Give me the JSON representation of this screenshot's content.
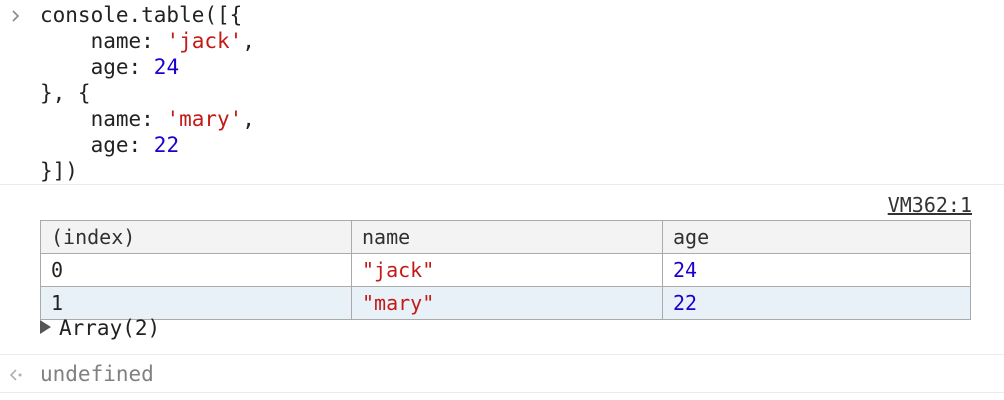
{
  "input": {
    "lines": [
      [
        {
          "t": "console.table([{",
          "c": "plain"
        }
      ],
      [
        {
          "t": "    name: ",
          "c": "plain"
        },
        {
          "t": "'jack'",
          "c": "str"
        },
        {
          "t": ",",
          "c": "plain"
        }
      ],
      [
        {
          "t": "    age: ",
          "c": "plain"
        },
        {
          "t": "24",
          "c": "num"
        }
      ],
      [
        {
          "t": "}, {",
          "c": "plain"
        }
      ],
      [
        {
          "t": "    name: ",
          "c": "plain"
        },
        {
          "t": "'mary'",
          "c": "str"
        },
        {
          "t": ",",
          "c": "plain"
        }
      ],
      [
        {
          "t": "    age: ",
          "c": "plain"
        },
        {
          "t": "22",
          "c": "num"
        }
      ],
      [
        {
          "t": "}])",
          "c": "plain"
        }
      ]
    ]
  },
  "output": {
    "source_link": "VM362:1",
    "table": {
      "headers": [
        "(index)",
        "name",
        "age"
      ],
      "rows": [
        {
          "index": "0",
          "name": "\"jack\"",
          "age": "24"
        },
        {
          "index": "1",
          "name": "\"mary\"",
          "age": "22"
        }
      ]
    },
    "array_label": "Array(2)"
  },
  "result": {
    "text": "undefined"
  },
  "icons": {
    "prompt": "chevron-right-icon",
    "result": "result-arrow-icon",
    "expand": "triangle-right-icon"
  },
  "colors": {
    "string": "#c41a16",
    "number": "#1c00cf",
    "alt_row": "#e8f0f8"
  }
}
